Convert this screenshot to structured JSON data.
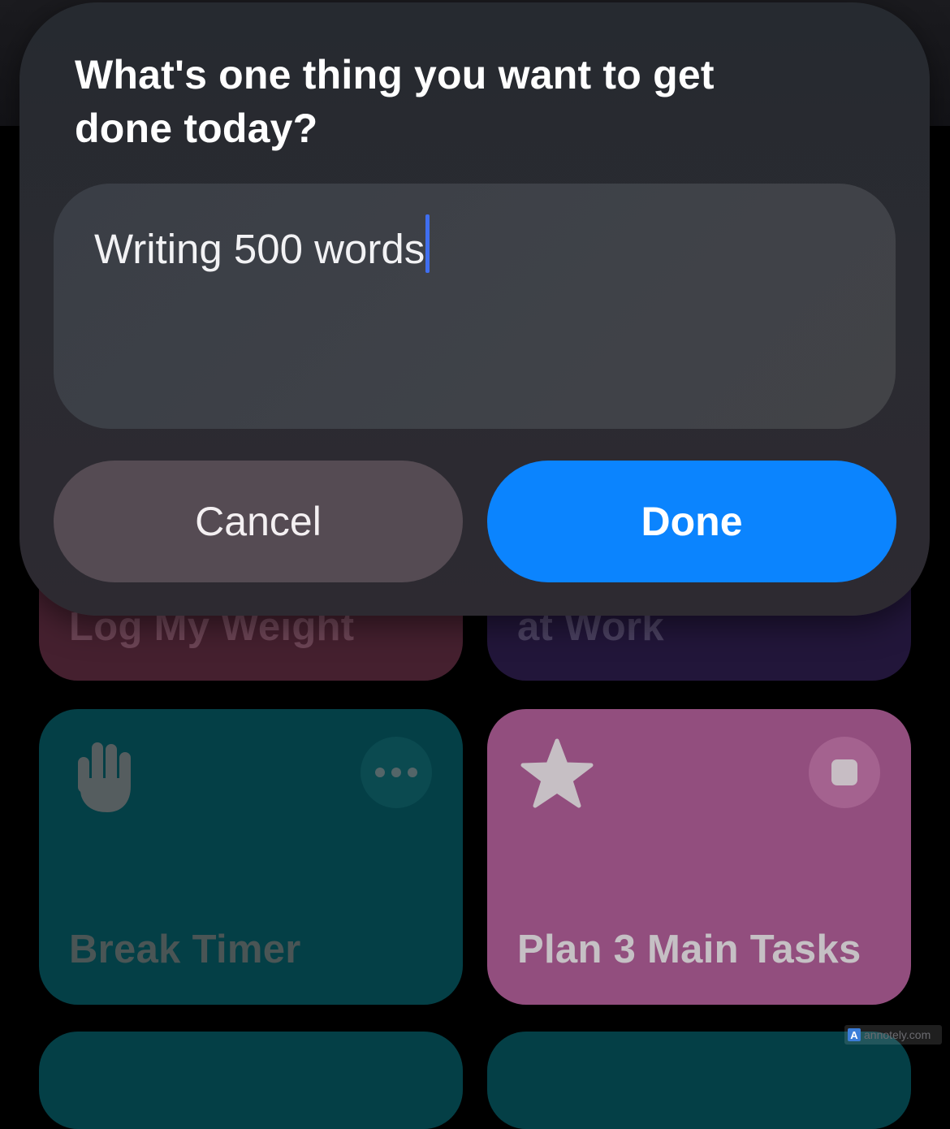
{
  "dialog": {
    "title": "What's one thing you want to get done today?",
    "input_value": "Writing 500 words",
    "cancel_label": "Cancel",
    "done_label": "Done"
  },
  "shortcuts": {
    "log_weight": "Log My Weight",
    "at_work": "at Work",
    "break_timer": "Break Timer",
    "plan_tasks": "Plan 3 Main Tasks"
  },
  "icons": {
    "break_timer": "hand-raised-icon",
    "break_timer_action": "more-icon",
    "plan_tasks": "star-icon",
    "plan_tasks_action": "stop-icon"
  },
  "colors": {
    "accent": "#0b84fe",
    "caret": "#3f6ef0"
  },
  "watermark": {
    "logo": "A",
    "text": "annotely.com"
  }
}
